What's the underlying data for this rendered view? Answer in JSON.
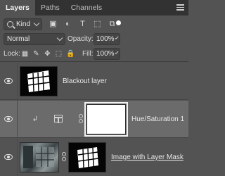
{
  "tabs": [
    {
      "label": "Layers",
      "active": true
    },
    {
      "label": "Paths",
      "active": false
    },
    {
      "label": "Channels",
      "active": false
    }
  ],
  "filter": {
    "kind_label": "Kind",
    "icons": [
      "image-filter-icon",
      "adjustment-filter-icon",
      "type-filter-icon",
      "shape-filter-icon",
      "smart-object-filter-icon"
    ],
    "icon_glyphs": [
      "▣",
      "◐",
      "T",
      "⬚",
      "⧉"
    ]
  },
  "blend": {
    "mode": "Normal",
    "opacity_label": "Opacity:",
    "opacity_value": "100%"
  },
  "lock": {
    "label": "Lock:",
    "icons": [
      "lock-transparent-icon",
      "lock-image-icon",
      "lock-position-icon",
      "lock-artboard-icon",
      "lock-all-icon"
    ],
    "icon_glyphs": [
      "▦",
      "✎",
      "✥",
      "⬚",
      "🔒"
    ],
    "fill_label": "Fill:",
    "fill_value": "100%"
  },
  "layers": [
    {
      "name": "Blackout layer",
      "selected": false
    },
    {
      "name": "Hue/Saturation 1",
      "selected": true
    },
    {
      "name": "Image with Layer Mask",
      "selected": false
    }
  ],
  "colors": {
    "panel_bg": "#535353",
    "tab_bar_bg": "#323232",
    "selected_layer_bg": "#6b6b6b",
    "text": "#e6e6e6"
  }
}
